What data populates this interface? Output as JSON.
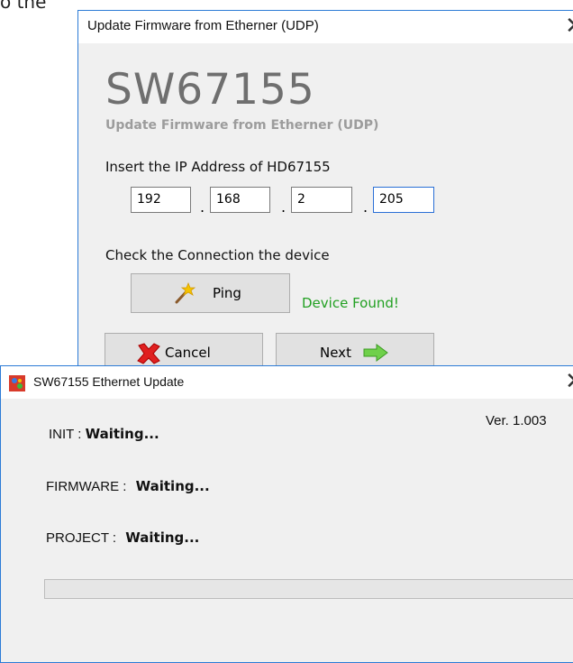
{
  "background": {
    "text": "o the"
  },
  "firmware_dialog": {
    "title": "Update Firmware from Etherner (UDP)",
    "close_icon": "close-icon",
    "product_name": "SW67155",
    "subtitle": "Update Firmware from Etherner (UDP)",
    "ip_prompt": "Insert the IP Address of HD67155",
    "ip_octets": [
      "192",
      "168",
      "2",
      "205"
    ],
    "ip_separator": ".",
    "connection_prompt": "Check the Connection the device",
    "ping_button": {
      "label": "Ping",
      "icon": "magic-wand-icon"
    },
    "ping_status": "Device Found!",
    "cancel_button": {
      "label": "Cancel",
      "icon": "red-x-icon"
    },
    "next_button": {
      "label": "Next",
      "icon": "green-arrow-right-icon"
    },
    "colors": {
      "status_ok": "#22a022",
      "title_text": "#6f6f6f",
      "border": "#2c7bd6"
    }
  },
  "update_dialog": {
    "title": "SW67155 Ethernet Update",
    "app_icon": "app-icon",
    "close_icon": "close-icon",
    "version": "Ver. 1.003",
    "init_label": "INIT :",
    "init_value": "Waiting...",
    "firmware_label": "FIRMWARE :",
    "firmware_value": "Waiting...",
    "project_label": "PROJECT :",
    "project_value": "Waiting...",
    "progress": 0
  }
}
